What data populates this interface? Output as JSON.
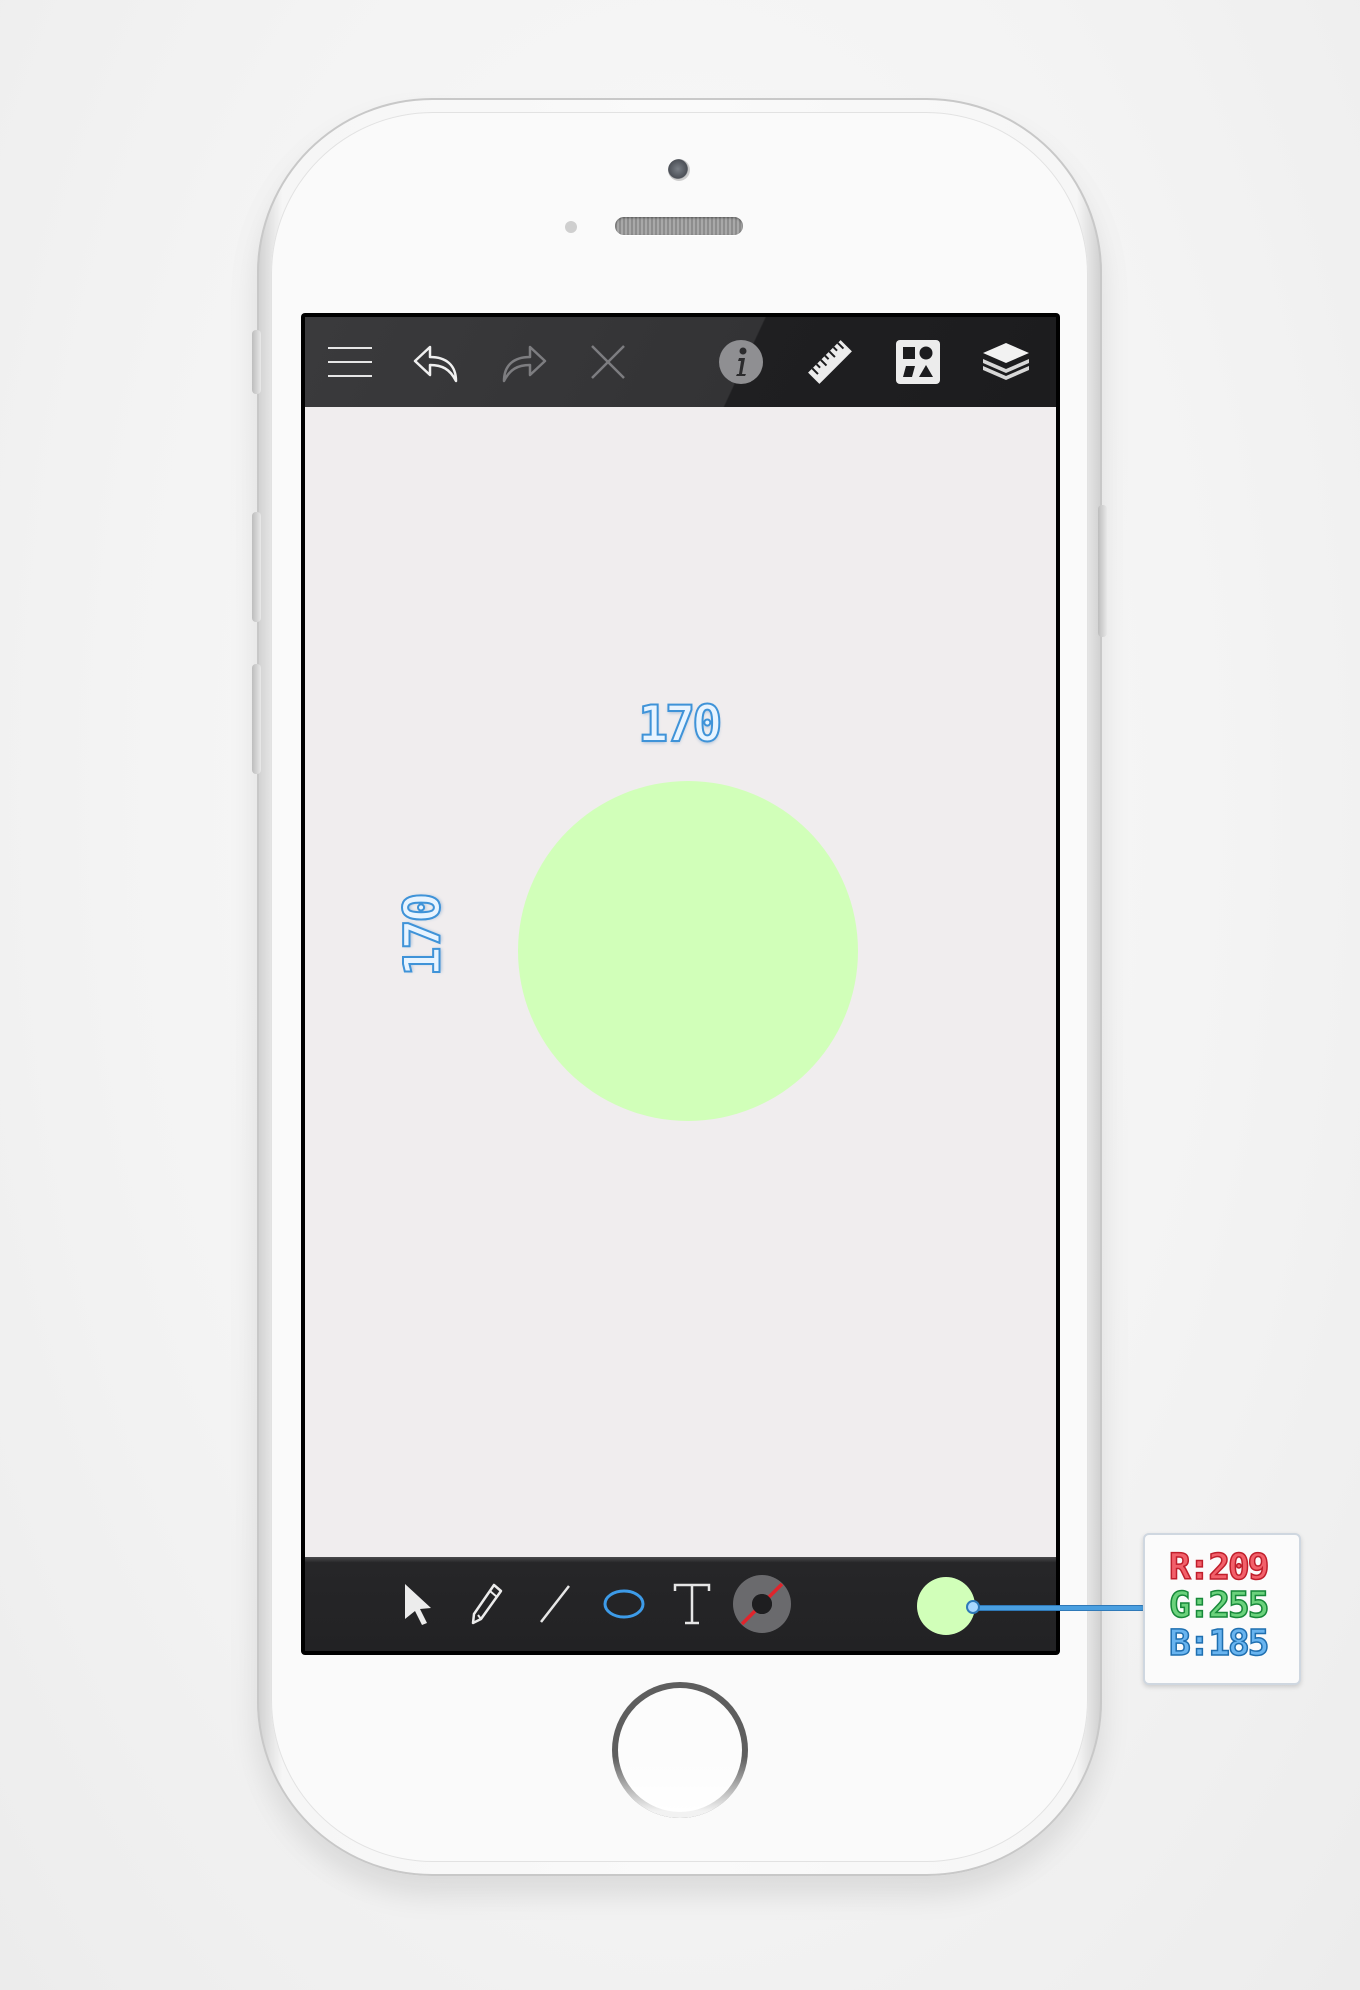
{
  "canvas": {
    "shape_fill": "#d1ffb9",
    "width_measure": "170",
    "height_measure": "170"
  },
  "toolbar_top": {
    "icons": [
      "menu-icon",
      "undo-icon",
      "redo-icon",
      "close-icon",
      "info-icon",
      "ruler-icon",
      "shapes-icon",
      "layers-icon"
    ]
  },
  "toolbar_bottom": {
    "icons": [
      "select-arrow-icon",
      "pencil-icon",
      "line-tool-icon",
      "ellipse-tool-icon",
      "text-tool-icon",
      "stroke-color-icon",
      "fill-color-swatch"
    ],
    "active_tool": "ellipse-tool-icon",
    "active_color": "#3d9be8"
  },
  "color_readout": {
    "r": "R:209",
    "g": "G:255",
    "b": "B:185"
  }
}
